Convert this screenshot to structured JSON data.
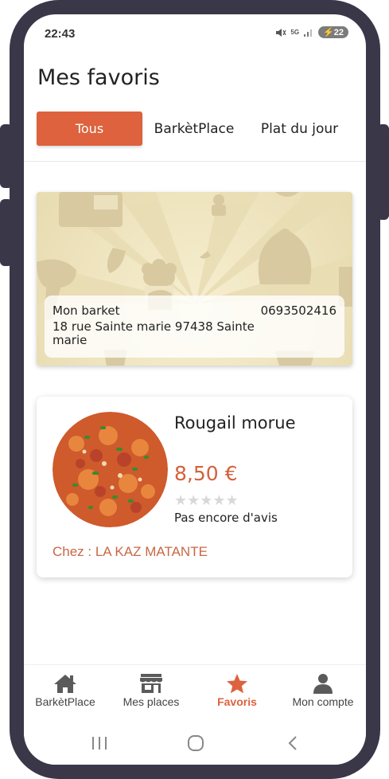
{
  "status_bar": {
    "time": "22:43",
    "network": "5G",
    "battery": "22"
  },
  "page": {
    "title": "Mes favoris"
  },
  "tabs": [
    {
      "label": "Tous",
      "active": true
    },
    {
      "label": "BarkètPlace",
      "active": false
    },
    {
      "label": "Plat du jour",
      "active": false
    }
  ],
  "favorites": {
    "place": {
      "name": "Mon barket",
      "phone": "0693502416",
      "address": "18 rue Sainte marie 97438 Sainte marie"
    },
    "dish": {
      "name": "Rougail morue",
      "price": "8,50 €",
      "stars": "★★★★★",
      "rating": 0,
      "reviews_text": "Pas encore d'avis",
      "restaurant": "Chez : LA KAZ MATANTE"
    }
  },
  "bottom_nav": [
    {
      "label": "BarkètPlace",
      "icon": "home-icon",
      "active": false
    },
    {
      "label": "Mes places",
      "icon": "store-icon",
      "active": false
    },
    {
      "label": "Favoris",
      "icon": "star-icon",
      "active": true
    },
    {
      "label": "Mon compte",
      "icon": "user-icon",
      "active": false
    }
  ],
  "colors": {
    "accent": "#dd623d",
    "frame": "#3a3748",
    "restaurant_text": "#c86845",
    "star_empty": "#d8d8d8"
  }
}
